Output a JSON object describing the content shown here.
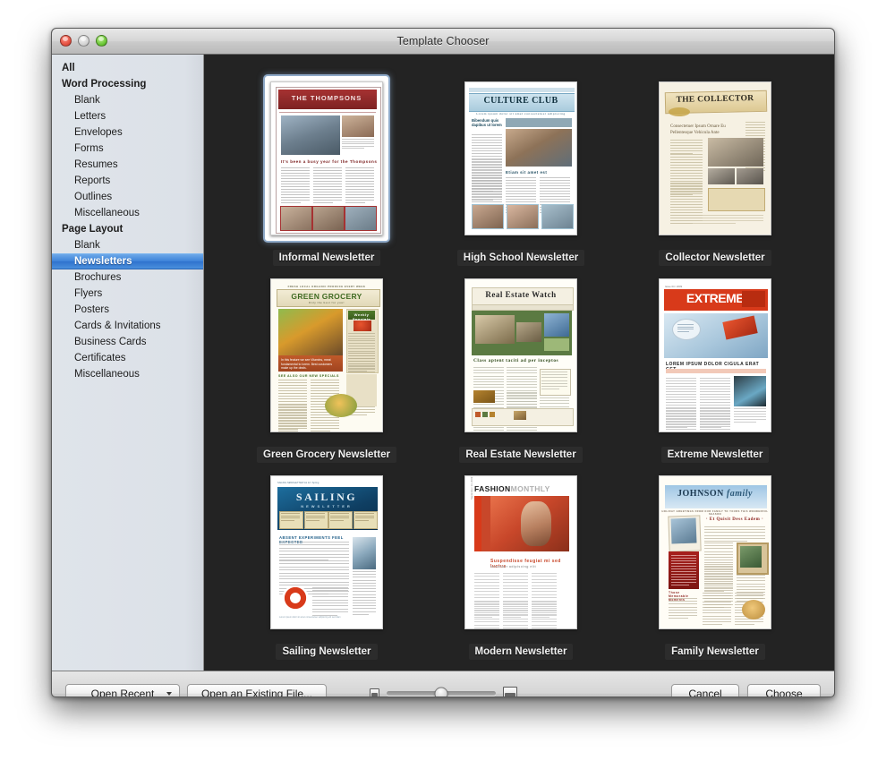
{
  "window": {
    "title": "Template Chooser",
    "traffic_lights": [
      "close-button",
      "minimize-button",
      "zoom-button"
    ]
  },
  "sidebar": {
    "items": [
      {
        "label": "All",
        "type": "group",
        "selected": false
      },
      {
        "label": "Word Processing",
        "type": "group",
        "selected": false
      },
      {
        "label": "Blank",
        "type": "child",
        "selected": false
      },
      {
        "label": "Letters",
        "type": "child",
        "selected": false
      },
      {
        "label": "Envelopes",
        "type": "child",
        "selected": false
      },
      {
        "label": "Forms",
        "type": "child",
        "selected": false
      },
      {
        "label": "Resumes",
        "type": "child",
        "selected": false
      },
      {
        "label": "Reports",
        "type": "child",
        "selected": false
      },
      {
        "label": "Outlines",
        "type": "child",
        "selected": false
      },
      {
        "label": "Miscellaneous",
        "type": "child",
        "selected": false
      },
      {
        "label": "Page Layout",
        "type": "group",
        "selected": false
      },
      {
        "label": "Blank",
        "type": "child",
        "selected": false
      },
      {
        "label": "Newsletters",
        "type": "child",
        "selected": true
      },
      {
        "label": "Brochures",
        "type": "child",
        "selected": false
      },
      {
        "label": "Flyers",
        "type": "child",
        "selected": false
      },
      {
        "label": "Posters",
        "type": "child",
        "selected": false
      },
      {
        "label": "Cards & Invitations",
        "type": "child",
        "selected": false
      },
      {
        "label": "Business Cards",
        "type": "child",
        "selected": false
      },
      {
        "label": "Certificates",
        "type": "child",
        "selected": false
      },
      {
        "label": "Miscellaneous",
        "type": "child",
        "selected": false
      }
    ],
    "selection_color": "#3c82d8"
  },
  "gallery": {
    "templates": [
      {
        "label": "Informal Newsletter",
        "selected": true,
        "masthead": "THE THOMPSONS",
        "headline": "It's been a busy year for the Thompsons",
        "accent": "#9e2b2b"
      },
      {
        "label": "High School Newsletter",
        "selected": false,
        "masthead": "CULTURE CLUB",
        "headline": "Etiam sit amet est",
        "subhead": "Bibendum quis dapibus ut lorem",
        "accent": "#2f6f93"
      },
      {
        "label": "Collector Newsletter",
        "selected": false,
        "masthead": "THE COLLECTOR",
        "headline": "Consectetuer Ipsum Ornare Eu Pellentesque Vehicula Ante",
        "accent": "#d8c89a"
      },
      {
        "label": "Green Grocery Newsletter",
        "selected": false,
        "masthead": "GREEN GROCERY",
        "headline": "Weekly Specials",
        "accent": "#4f7a2a"
      },
      {
        "label": "Real Estate Newsletter",
        "selected": false,
        "masthead": "Real Estate Watch",
        "headline": "Class aptent taciti ad per inceptos",
        "accent": "#4d6b3a"
      },
      {
        "label": "Extreme Newsletter",
        "selected": false,
        "masthead": "EXTREME",
        "headline": "LOREM IPSUM DOLOR CIGULA ERAT GET...",
        "accent": "#d03a1e"
      },
      {
        "label": "Sailing Newsletter",
        "selected": false,
        "masthead": "SAILING",
        "submasthead": "NEWSLETTER",
        "headline": "ABSENT EXPERIMENTS FEEL EXPECTED",
        "accent": "#1b5b86"
      },
      {
        "label": "Modern Newsletter",
        "selected": false,
        "masthead": "FASHION",
        "masthead2": "MONTHLY",
        "headline": "Suspendisse feugiat mi sed luctus",
        "accent": "#c8472a"
      },
      {
        "label": "Family Newsletter",
        "selected": false,
        "masthead": "JOHNSON",
        "masthead2": "family",
        "headline": "Et Quisit Dess Eadem",
        "accent": "#8d2420"
      }
    ]
  },
  "toolbar": {
    "open_recent_label": "Open Recent",
    "open_existing_label": "Open an Existing File...",
    "cancel_label": "Cancel",
    "choose_label": "Choose",
    "slider": {
      "small_icon": "small-image-icon",
      "large_icon": "large-image-icon",
      "value_percent": 50
    }
  }
}
